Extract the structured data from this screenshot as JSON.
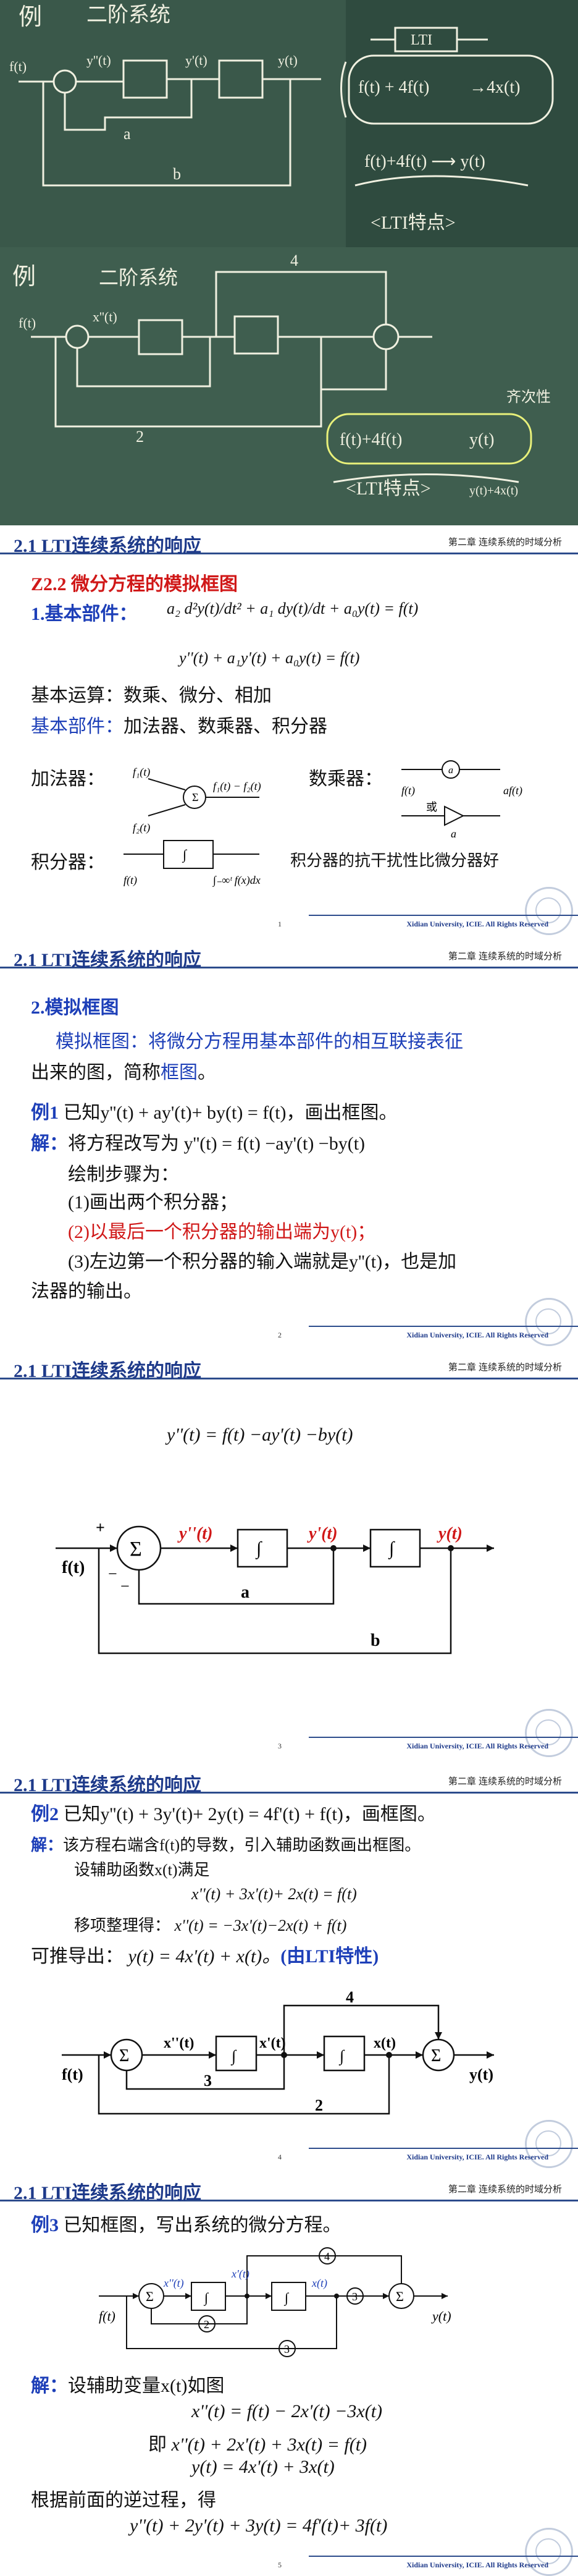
{
  "board1": {
    "heading": "例",
    "subtitle": "二阶系统",
    "f_label": "f(t)",
    "y2_label": "y''(t)",
    "y1_label": "y'(t)",
    "y_label": "y(t)",
    "a_label": "a",
    "b_label": "b",
    "lti_label": "LTI",
    "eq1": "f(t) + 4f(t)",
    "eq2": "→4x(t)",
    "eq3": "f(t)+4f(t) ⟶ y(t)",
    "note": "<LTI特点>"
  },
  "board2": {
    "heading": "例",
    "subtitle": "二阶系统",
    "f_label": "f(t)",
    "x2_label": "x''(t)",
    "four_label": "4",
    "two_label": "2",
    "eq1": "f(t)+4f(t)",
    "eq2": "y(t)",
    "note": "<LTI特点>",
    "right_note": "齐次性",
    "right_eq": "y(t)+4x(t)"
  },
  "slides": {
    "header_title": "2.1  LTI连续系统的响应",
    "header_chapter": "第二章 连续系统的时域分析",
    "copyright": "Xidian University, ICIE. All Rights Reserved"
  },
  "slide1": {
    "page": "1",
    "section": "Z2.2  微分方程的模拟框图",
    "item1": "1.基本部件：",
    "eq_top": "a₂ d²y(t)/dt² + a₁ dy(t)/dt + a₀y(t) = f(t)",
    "eq_mid": "y''(t) + a₁y'(t) + a₀y(t) = f(t)",
    "ops_label": "基本运算：数乘、微分、相加",
    "parts_label": "基本部件：",
    "parts_value": "加法器、数乘器、积分器",
    "adder_label": "加法器：",
    "adder_f1": "f₁(t)",
    "adder_f2": "f₂(t)",
    "adder_out": "f₁(t) − f₂(t)",
    "mult_label": "数乘器：",
    "mult_in": "f(t)",
    "mult_out": "af(t)",
    "mult_or": "或",
    "mult_a": "a",
    "int_label": "积分器：",
    "int_in": "f(t)",
    "int_out": "∫₋∞ᵗ f(x)dx",
    "int_note": "积分器的抗干扰性比微分器好"
  },
  "slide2": {
    "page": "2",
    "section": "2.模拟框图",
    "para1": "模拟框图：将微分方程用基本部件的相互联接表征",
    "para1_b": "出来的图，简称",
    "para1_c": "框图",
    "para1_d": "。",
    "ex_label": "例1",
    "ex_text": " 已知y''(t) + ay'(t)+ by(t) = f(t)，画出框图。",
    "sol_label": "解：",
    "sol_text": "将方程改写为    y''(t) = f(t) −ay'(t) −by(t)",
    "steps": "绘制步骤为：",
    "step1": "(1)画出两个积分器；",
    "step2": "(2)以最后一个积分器的输出端为y(t)；",
    "step3": "(3)左边第一个积分器的输入端就是y''(t)，也是加",
    "step3_b": "法器的输出。"
  },
  "slide3": {
    "page": "3",
    "eq": "y''(t) = f(t) −ay'(t) −by(t)",
    "plus": "+",
    "minus": "−",
    "sigma": "Σ",
    "f_in": "f(t)",
    "y2": "y''(t)",
    "y1": "y'(t)",
    "y0": "y(t)",
    "a": "a",
    "b": "b",
    "int": "∫"
  },
  "slide4": {
    "page": "4",
    "ex_label": "例2",
    "ex_text": " 已知y''(t) + 3y'(t)+ 2y(t) = 4f'(t) + f(t)，画框图。",
    "sol_label": "解：",
    "sol_text": "该方程右端含f(t)的导数，引入辅助函数画出框图。",
    "line2": "设辅助函数x(t)满足",
    "line3": "x''(t) + 3x'(t)+ 2x(t) = f(t)",
    "line4_label": "移项整理得：",
    "line4": "x''(t) = −3x'(t)−2x(t) + f(t)",
    "line5_label": "可推导出：",
    "line5": "y(t) = 4x'(t) + x(t)。",
    "line5_note": "(由LTI特性)",
    "f_in": "f(t)",
    "x2": "x''(t)",
    "x1": "x'(t)",
    "x0": "x(t)",
    "y_out": "y(t)",
    "g3": "3",
    "g2": "2",
    "g4": "4"
  },
  "slide5": {
    "page": "5",
    "ex_label": "例3",
    "ex_text": " 已知框图，写出系统的微分方程。",
    "sol_label": "解：",
    "sol_text": "设辅助变量x(t)如图",
    "eq1": "x''(t) = f(t) − 2x'(t) −3x(t)",
    "eq2_label": "即",
    "eq2": "x''(t) + 2x'(t) + 3x(t) = f(t)",
    "eq3": "y(t) = 4x'(t) + 3x(t)",
    "line": "根据前面的逆过程，得",
    "eq4": "y''(t) + 2y'(t) + 3y(t) = 4f'(t)+ 3f(t)",
    "f_in": "f(t)",
    "y_out": "y(t)",
    "x2": "x''(t)",
    "x1": "x'(t)",
    "x0": "x(t)",
    "g4": "4",
    "g2": "2",
    "g3": "3"
  }
}
